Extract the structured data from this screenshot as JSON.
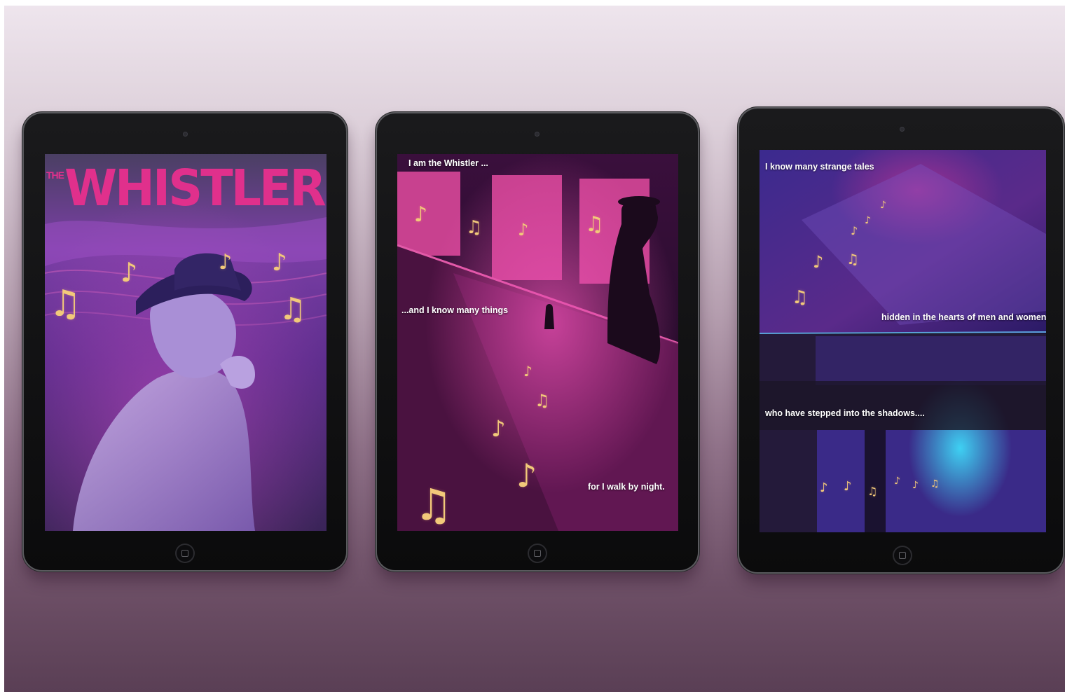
{
  "tablets": [
    {
      "title_small": "THE",
      "title_large": "WHISTLER"
    },
    {
      "captions": [
        "I am the Whistler ...",
        "...and I know many things",
        "for I walk by night."
      ]
    },
    {
      "captions": [
        "I know many strange tales",
        "hidden in the hearts of men and women",
        "who have stepped into the shadows...."
      ]
    }
  ],
  "icons": {
    "note": "music-note-icon",
    "notes": "music-notes-icon"
  },
  "colors": {
    "accent": "#e0308c",
    "note": "#f2c97a",
    "bezel": "#0e0e10",
    "purple": "#5b2d8c"
  }
}
